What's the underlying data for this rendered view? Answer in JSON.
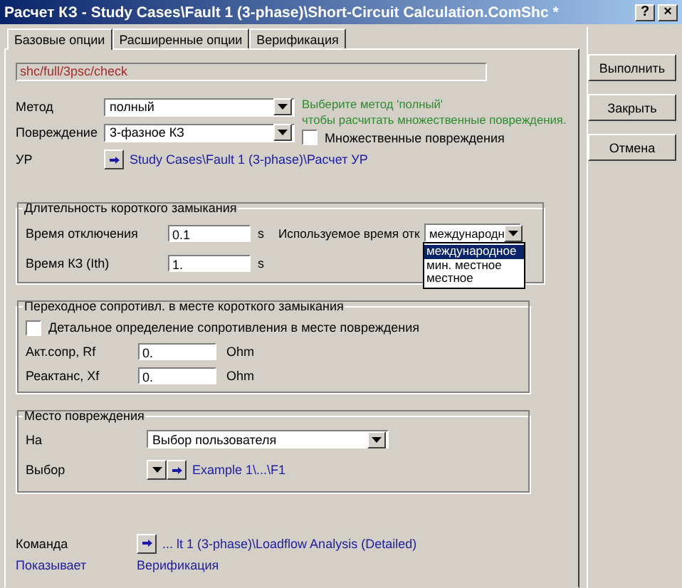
{
  "window": {
    "title": "Расчет КЗ - Study Cases\\Fault 1 (3-phase)\\Short-Circuit Calculation.ComShc *",
    "help": "?",
    "close": "×"
  },
  "tabs": [
    {
      "label": "Базовые опции",
      "selected": true
    },
    {
      "label": "Расширенные опции",
      "selected": false
    },
    {
      "label": "Верификация",
      "selected": false
    }
  ],
  "path_field": "shc/full/3psc/check",
  "method": {
    "label": "Метод",
    "value": "полный"
  },
  "fault": {
    "label": "Повреждение",
    "value": "3-фазное КЗ"
  },
  "hint": [
    "Выберите метод 'полный'",
    "чтобы расчитать множественные повреждения."
  ],
  "multiple_faults": {
    "label": "Множественные повреждения",
    "checked": false
  },
  "load_flow": {
    "label": "УР",
    "link": "Study Cases\\Fault 1 (3-phase)\\Расчет УР"
  },
  "duration": {
    "title": "Длительность короткого замыкания",
    "clearing_time": {
      "label": "Время отключения",
      "value": "0.1",
      "unit": "s"
    },
    "fault_time": {
      "label": "Время КЗ (Ith)",
      "value": "1.",
      "unit": "s"
    },
    "used_time": {
      "label": "Используемое время отк",
      "value": "международн",
      "options": [
        {
          "label": "международное",
          "selected": true
        },
        {
          "label": "мин. местное",
          "selected": false
        },
        {
          "label": "местное",
          "selected": false
        }
      ]
    }
  },
  "resistance": {
    "title": "Переходное сопротивл. в месте короткого замыкания",
    "detailed": {
      "label": "Детальное определение сопротивления в месте повреждения",
      "checked": false
    },
    "rf": {
      "label": "Акт.сопр, Rf",
      "value": "0.",
      "unit": "Ohm"
    },
    "xf": {
      "label": "Реактанс, Xf",
      "value": "0.",
      "unit": "Ohm"
    }
  },
  "location": {
    "title": "Место повреждения",
    "at": {
      "label": "На",
      "value": "Выбор пользователя"
    },
    "selection": {
      "label": "Выбор",
      "link": "Example 1\\...\\F1"
    }
  },
  "command": {
    "label": "Команда",
    "link": "... lt 1 (3-phase)\\Loadflow Analysis (Detailed)"
  },
  "shows": {
    "label": "Показывает",
    "value": "Верификация"
  },
  "buttons": [
    "Выполнить",
    "Закрыть",
    "Отмена"
  ]
}
